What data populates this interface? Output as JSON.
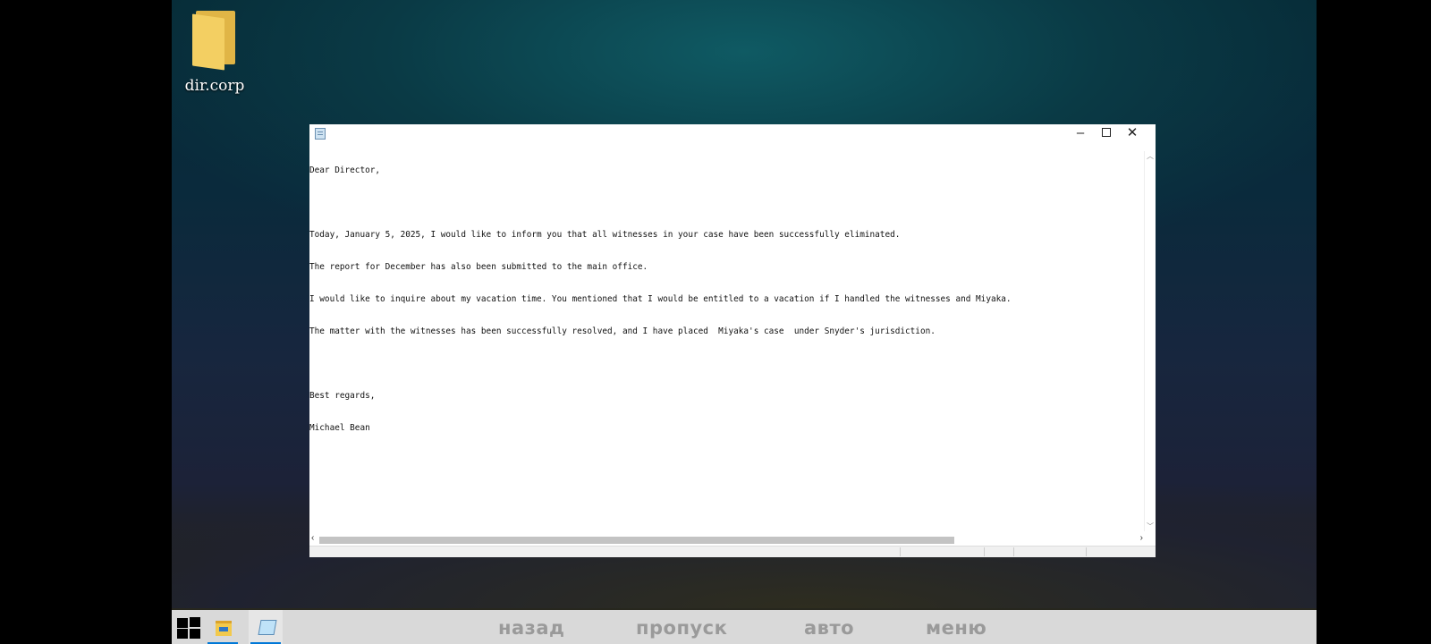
{
  "desktop": {
    "icons": [
      {
        "label": "dir.corp",
        "icon": "folder-icon"
      }
    ]
  },
  "notepad": {
    "title": "",
    "window_controls": {
      "minimize": "–",
      "maximize": "□",
      "close": "✕"
    },
    "lines": [
      "Dear Director,",
      "",
      "Today, January 5, 2025, I would like to inform you that all witnesses in your case have been successfully eliminated.",
      "The report for December has also been submitted to the main office.",
      "I would like to inquire about my vacation time. You mentioned that I would be entitled to a vacation if I handled the witnesses and Miyaka.",
      "The matter with the witnesses has been successfully resolved, and I have placed  Miyaka's case  under Snyder's jurisdiction.",
      "",
      "Best regards,",
      "Michael Bean"
    ]
  },
  "taskbar": {
    "apps": [
      "start-icon",
      "file-explorer-icon",
      "notepad-icon"
    ],
    "nav": [
      "назад",
      "пропуск",
      "авто",
      "меню"
    ]
  }
}
